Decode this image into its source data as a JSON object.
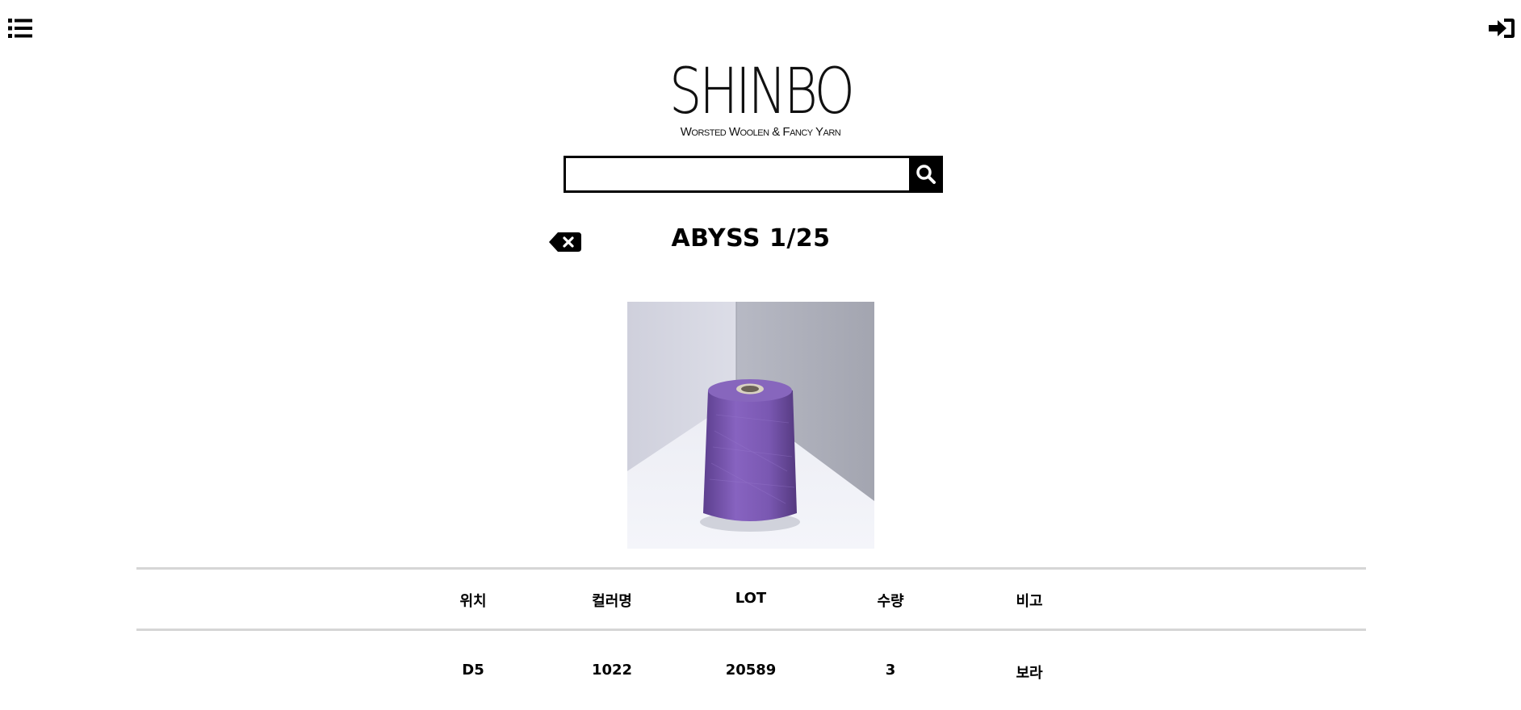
{
  "header": {
    "menu_icon": "list-icon",
    "login_icon": "sign-in-icon"
  },
  "logo": {
    "wordmark": "SHINBO",
    "tagline": "Worsted Woolen & Fancy Yarn"
  },
  "search": {
    "value": "",
    "placeholder": "",
    "button_icon": "search-icon"
  },
  "product": {
    "back_icon": "backspace-icon",
    "title": "ABYSS 1/25",
    "image_color": "#7b58b0"
  },
  "table": {
    "headers": [
      "위치",
      "컬러명",
      "LOT",
      "수량",
      "비고"
    ],
    "rows": [
      [
        "D5",
        "1022",
        "20589",
        "3",
        "보라"
      ]
    ]
  }
}
